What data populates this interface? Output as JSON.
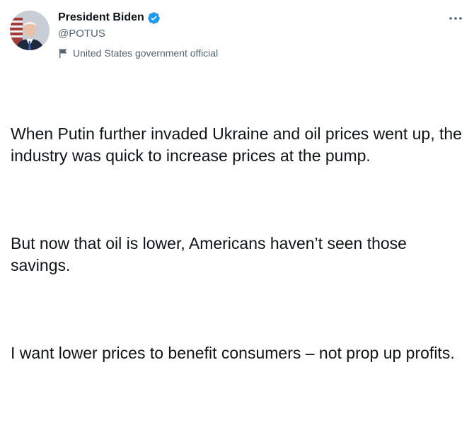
{
  "author": {
    "display_name": "President Biden",
    "handle": "@POTUS",
    "label": "United States government official",
    "verified": true
  },
  "tweet": {
    "paragraphs": [
      "When Putin further invaded Ukraine and oil prices went up, the industry was quick to increase prices at the pump.",
      "But now that oil is lower, Americans haven’t seen those savings.",
      "I want lower prices to benefit consumers – not prop up profits."
    ]
  },
  "icons": {
    "verified": "verified-badge-icon",
    "label": "flag-icon",
    "more": "more-options-icon"
  },
  "colors": {
    "verified_blue": "#1d9bf0",
    "text_primary": "#0f1419",
    "text_secondary": "#536471"
  }
}
